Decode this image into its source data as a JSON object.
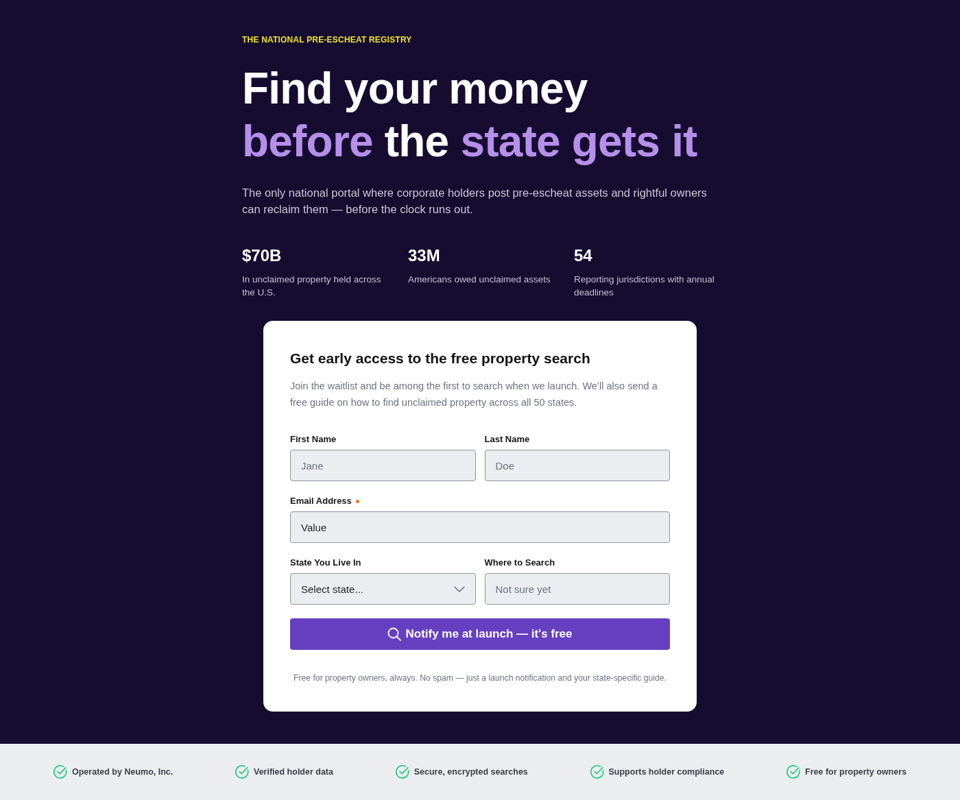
{
  "hero": {
    "eyebrow": "THE NATIONAL PRE-ESCHEAT REGISTRY",
    "headline": [
      [
        {
          "text": "Find your money",
          "highlight": false
        }
      ],
      [
        {
          "text": "before",
          "highlight": true
        },
        {
          "text": "the",
          "highlight": false
        },
        {
          "text": "state gets it",
          "highlight": true
        }
      ]
    ],
    "subtitle": "The only national portal where corporate holders post pre-escheat assets and rightful owners can reclaim them — before the clock runs out."
  },
  "stats": [
    {
      "value": "$70B",
      "description": "In unclaimed property held across the U.S."
    },
    {
      "value": "33M",
      "description": "Americans owed unclaimed assets"
    },
    {
      "value": "54",
      "description": "Reporting jurisdictions with annual deadlines"
    }
  ],
  "signup_card": {
    "title": "Get early access to the free property search",
    "description": "Join the waitlist and be among the first to search when we launch. We’ll also send a free guide on how to find unclaimed property across all 50 states.",
    "rows": [
      [
        {
          "kind": "text",
          "label": "First Name",
          "placeholder": "Jane",
          "required": false
        },
        {
          "kind": "text",
          "label": "Last Name",
          "placeholder": "Doe",
          "required": false
        }
      ],
      [
        {
          "kind": "email",
          "label": "Email Address",
          "value": "Value",
          "required": true
        }
      ],
      [
        {
          "kind": "select",
          "label": "State You Live In",
          "value": "Select state...",
          "required": false
        },
        {
          "kind": "text",
          "label": "Where to Search",
          "placeholder": "Not sure yet",
          "required": false
        }
      ]
    ],
    "submit_button": "Notify me at launch — it's free",
    "disclaimer": "Free for property owners, always. No spam — just a launch notification and your state-specific guide."
  },
  "footer": {
    "features": [
      "Operated by Neumo, Inc.",
      "Verified holder data",
      "Secure, encrypted searches",
      "Supports holder compliance",
      "Free for property owners"
    ]
  }
}
